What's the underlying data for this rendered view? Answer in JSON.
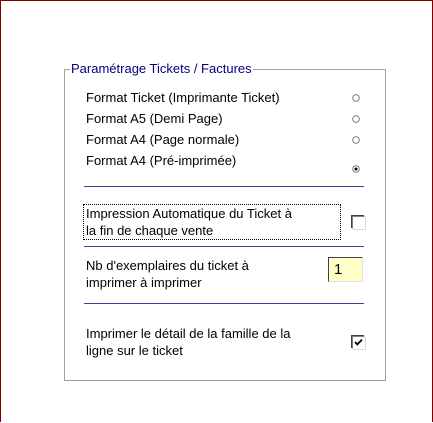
{
  "group": {
    "title": "Paramétrage Tickets / Factures"
  },
  "formats": [
    {
      "label": "Format Ticket (Imprimante Ticket)",
      "selected": false
    },
    {
      "label": "Format A5 (Demi Page)",
      "selected": false
    },
    {
      "label": "Format A4 (Page normale)",
      "selected": false
    },
    {
      "label": "Format A4 (Pré-imprimée)",
      "selected": true
    }
  ],
  "auto_print": {
    "label_line1": "Impression Automatique du Ticket à",
    "label_line2": "la fin de chaque vente",
    "checked": false
  },
  "copies": {
    "label_line1": "Nb d'exemplaires du ticket à",
    "label_line2": "imprimer à imprimer",
    "value": "1"
  },
  "family_detail": {
    "label_line1": "Imprimer le détail de la famille de la",
    "label_line2": "ligne sur le ticket",
    "checked": true
  },
  "colors": {
    "window_border": "#800000",
    "group_title": "#000080",
    "separator": "#4040a0",
    "input_bg": "#ffffc8"
  }
}
